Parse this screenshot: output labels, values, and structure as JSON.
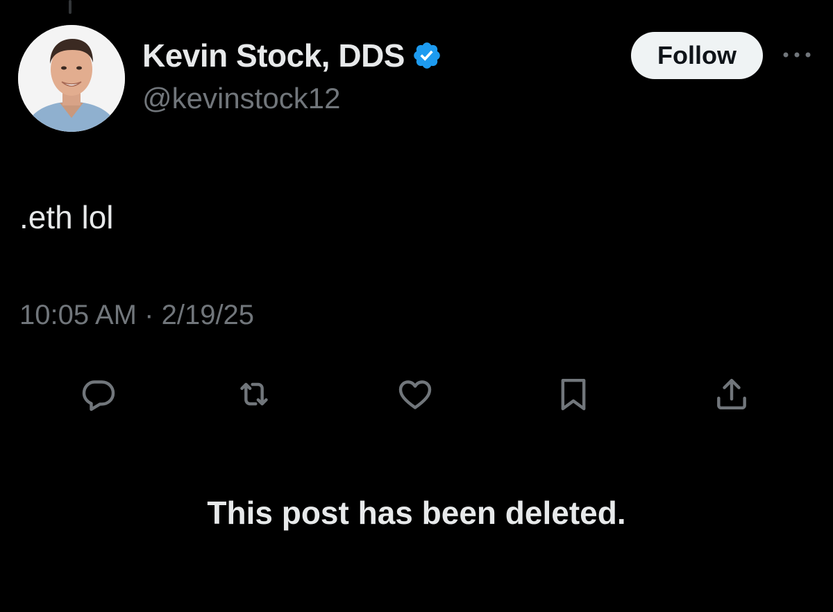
{
  "author": {
    "display_name": "Kevin Stock, DDS",
    "handle": "@kevinstock12",
    "verified": true,
    "avatar": "profile-photo"
  },
  "header": {
    "follow_label": "Follow",
    "more_icon": "more-horizontal-icon"
  },
  "post": {
    "text": ".eth lol",
    "time": "10:05 AM",
    "separator": "·",
    "date": "2/19/25"
  },
  "actions": [
    {
      "name": "reply",
      "icon": "reply-icon"
    },
    {
      "name": "repost",
      "icon": "repost-icon"
    },
    {
      "name": "like",
      "icon": "heart-icon"
    },
    {
      "name": "bookmark",
      "icon": "bookmark-icon"
    },
    {
      "name": "share",
      "icon": "share-icon"
    }
  ],
  "notice": {
    "text": "This post has been deleted."
  },
  "colors": {
    "background": "#000000",
    "primary_text": "#e7e9ea",
    "secondary_text": "#71767b",
    "verified_blue": "#1d9bf0",
    "follow_button_bg": "#eff3f4"
  }
}
